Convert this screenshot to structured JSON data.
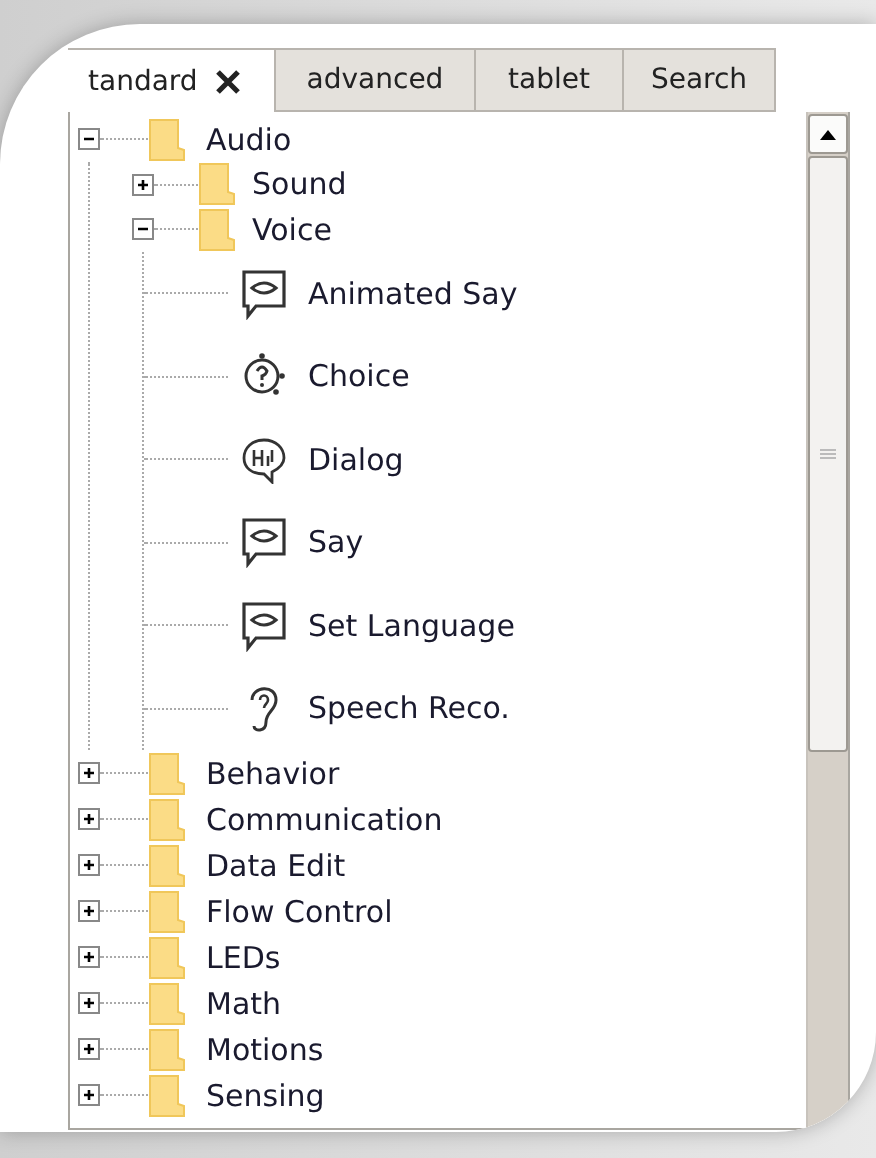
{
  "tabs": [
    {
      "label": "tandard",
      "selected": true,
      "closable": true
    },
    {
      "label": "advanced",
      "selected": false
    },
    {
      "label": "tablet",
      "selected": false
    },
    {
      "label": "Search",
      "selected": false
    }
  ],
  "tree": [
    {
      "kind": "folder",
      "label": "Audio",
      "expanded": true,
      "children": [
        {
          "kind": "folder",
          "label": "Sound",
          "expanded": false
        },
        {
          "kind": "folder",
          "label": "Voice",
          "expanded": true,
          "children": [
            {
              "kind": "speech",
              "label": "Animated Say"
            },
            {
              "kind": "choice",
              "label": "Choice"
            },
            {
              "kind": "dialog",
              "label": "Dialog"
            },
            {
              "kind": "speech",
              "label": "Say"
            },
            {
              "kind": "speech",
              "label": "Set Language"
            },
            {
              "kind": "listen",
              "label": "Speech Reco."
            }
          ]
        }
      ]
    },
    {
      "kind": "folder",
      "label": "Behavior",
      "expanded": false
    },
    {
      "kind": "folder",
      "label": "Communication",
      "expanded": false
    },
    {
      "kind": "folder",
      "label": "Data Edit",
      "expanded": false
    },
    {
      "kind": "folder",
      "label": "Flow Control",
      "expanded": false
    },
    {
      "kind": "folder",
      "label": "LEDs",
      "expanded": false
    },
    {
      "kind": "folder",
      "label": "Math",
      "expanded": false
    },
    {
      "kind": "folder",
      "label": "Motions",
      "expanded": false
    },
    {
      "kind": "folder",
      "label": "Sensing",
      "expanded": false
    }
  ]
}
